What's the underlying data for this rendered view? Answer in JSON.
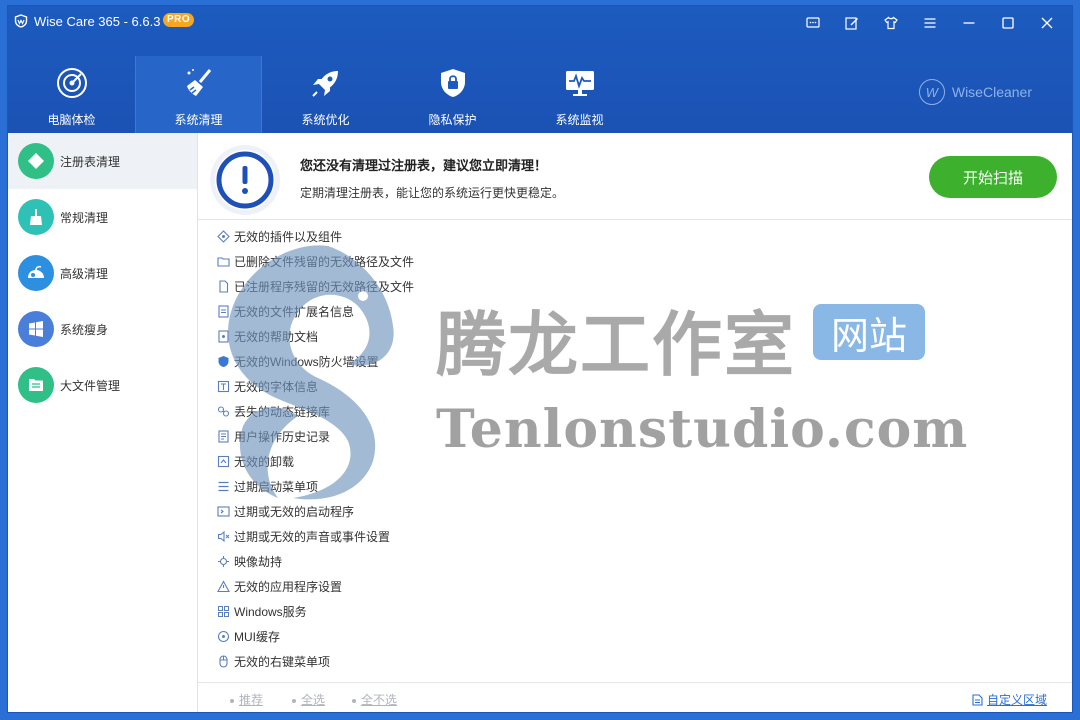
{
  "app": {
    "title": "Wise Care 365 - 6.6.3",
    "badge": "PRO",
    "brand": "WiseCleaner",
    "brand_mark": "W"
  },
  "nav": {
    "items": [
      {
        "label": "电脑体检",
        "icon": "health-check-icon"
      },
      {
        "label": "系统清理",
        "icon": "broom-clean-icon",
        "active": true
      },
      {
        "label": "系统优化",
        "icon": "rocket-icon"
      },
      {
        "label": "隐私保护",
        "icon": "privacy-lock-icon"
      },
      {
        "label": "系统监视",
        "icon": "monitor-icon"
      }
    ]
  },
  "sidebar": {
    "items": [
      {
        "label": "注册表清理",
        "icon": "registry-icon",
        "color": "#2fbf87",
        "active": true
      },
      {
        "label": "常规清理",
        "icon": "broom-icon",
        "color": "#2fc0b6"
      },
      {
        "label": "高级清理",
        "icon": "vacuum-icon",
        "color": "#2d8fe0"
      },
      {
        "label": "系统瘦身",
        "icon": "windows-icon",
        "color": "#4a7fd9"
      },
      {
        "label": "大文件管理",
        "icon": "file-manager-icon",
        "color": "#2fbf87"
      }
    ]
  },
  "banner": {
    "title": "您还没有清理过注册表，建议您立即清理！",
    "subtitle": "定期清理注册表，能让您的系统运行更快更稳定。",
    "scan_button": "开始扫描"
  },
  "items": [
    {
      "label": "无效的插件以及组件",
      "icon": "plugin-icon"
    },
    {
      "label": "已删除文件残留的无效路径及文件",
      "icon": "folder-icon"
    },
    {
      "label": "已注册程序残留的无效路径及文件",
      "icon": "file-icon"
    },
    {
      "label": "无效的文件扩展名信息",
      "icon": "file-extension-icon"
    },
    {
      "label": "无效的帮助文档",
      "icon": "help-doc-icon"
    },
    {
      "label": "无效的Windows防火墙设置",
      "icon": "firewall-icon"
    },
    {
      "label": "无效的字体信息",
      "icon": "font-icon"
    },
    {
      "label": "丢失的动态链接库",
      "icon": "link-icon"
    },
    {
      "label": "用户操作历史记录",
      "icon": "history-icon"
    },
    {
      "label": "无效的卸载",
      "icon": "uninstall-icon"
    },
    {
      "label": "过期启动菜单项",
      "icon": "start-menu-icon"
    },
    {
      "label": "过期或无效的启动程序",
      "icon": "startup-icon"
    },
    {
      "label": "过期或无效的声音或事件设置",
      "icon": "sound-icon"
    },
    {
      "label": "映像劫持",
      "icon": "image-hijack-icon"
    },
    {
      "label": "无效的应用程序设置",
      "icon": "warning-icon"
    },
    {
      "label": "Windows服务",
      "icon": "windows-service-icon"
    },
    {
      "label": "MUI缓存",
      "icon": "cache-icon"
    },
    {
      "label": "无效的右键菜单项",
      "icon": "mouse-icon"
    }
  ],
  "footer": {
    "recommend": "推荐",
    "select_all": "全选",
    "select_none": "全不选",
    "custom_area": "自定义区域"
  },
  "watermark": {
    "cn": "腾龙工作室",
    "box": "网站",
    "en": "Tenlonstudio.com"
  },
  "colors": {
    "header": "#1d5bbf",
    "accent_green": "#3db12e",
    "link_blue": "#2a6fd6"
  }
}
